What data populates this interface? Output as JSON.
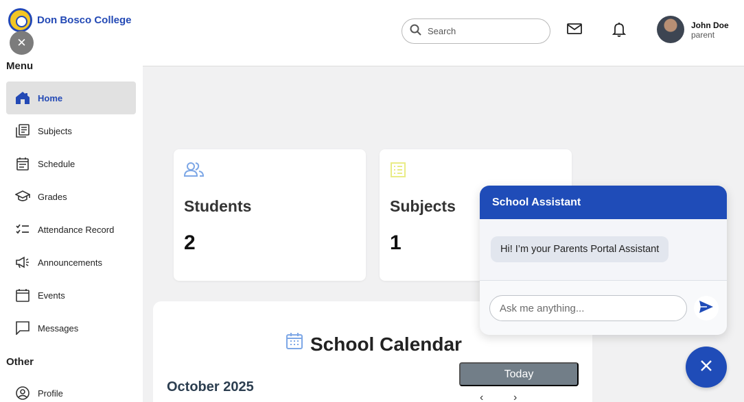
{
  "brand": {
    "name": "Don Bosco College"
  },
  "sidebar": {
    "menu_label": "Menu",
    "other_label": "Other",
    "items": [
      {
        "label": "Home",
        "icon": "home-icon",
        "active": true
      },
      {
        "label": "Subjects",
        "icon": "subjects-icon"
      },
      {
        "label": "Schedule",
        "icon": "schedule-icon"
      },
      {
        "label": "Grades",
        "icon": "graduation-cap-icon"
      },
      {
        "label": "Attendance Record",
        "icon": "checklist-icon"
      },
      {
        "label": "Announcements",
        "icon": "megaphone-icon"
      },
      {
        "label": "Events",
        "icon": "calendar-icon"
      },
      {
        "label": "Messages",
        "icon": "chat-icon"
      }
    ],
    "other_items": [
      {
        "label": "Profile",
        "icon": "user-circle-icon"
      }
    ]
  },
  "header": {
    "search_placeholder": "Search",
    "user": {
      "name": "John Doe",
      "role": "parent"
    }
  },
  "cards": [
    {
      "title": "Students",
      "value": "2",
      "icon": "users-icon",
      "icon_color": "#7da7e6"
    },
    {
      "title": "Subjects",
      "value": "1",
      "icon": "list-icon",
      "icon_color": "#e9ec86"
    }
  ],
  "calendar": {
    "title": "School Calendar",
    "month": "October 2025",
    "today_label": "Today"
  },
  "chat": {
    "title": "School Assistant",
    "greeting": "Hi! I’m your Parents Portal Assistant",
    "input_placeholder": "Ask me anything..."
  },
  "colors": {
    "accent": "#1f4cb8",
    "brand_text": "#2349b5"
  }
}
